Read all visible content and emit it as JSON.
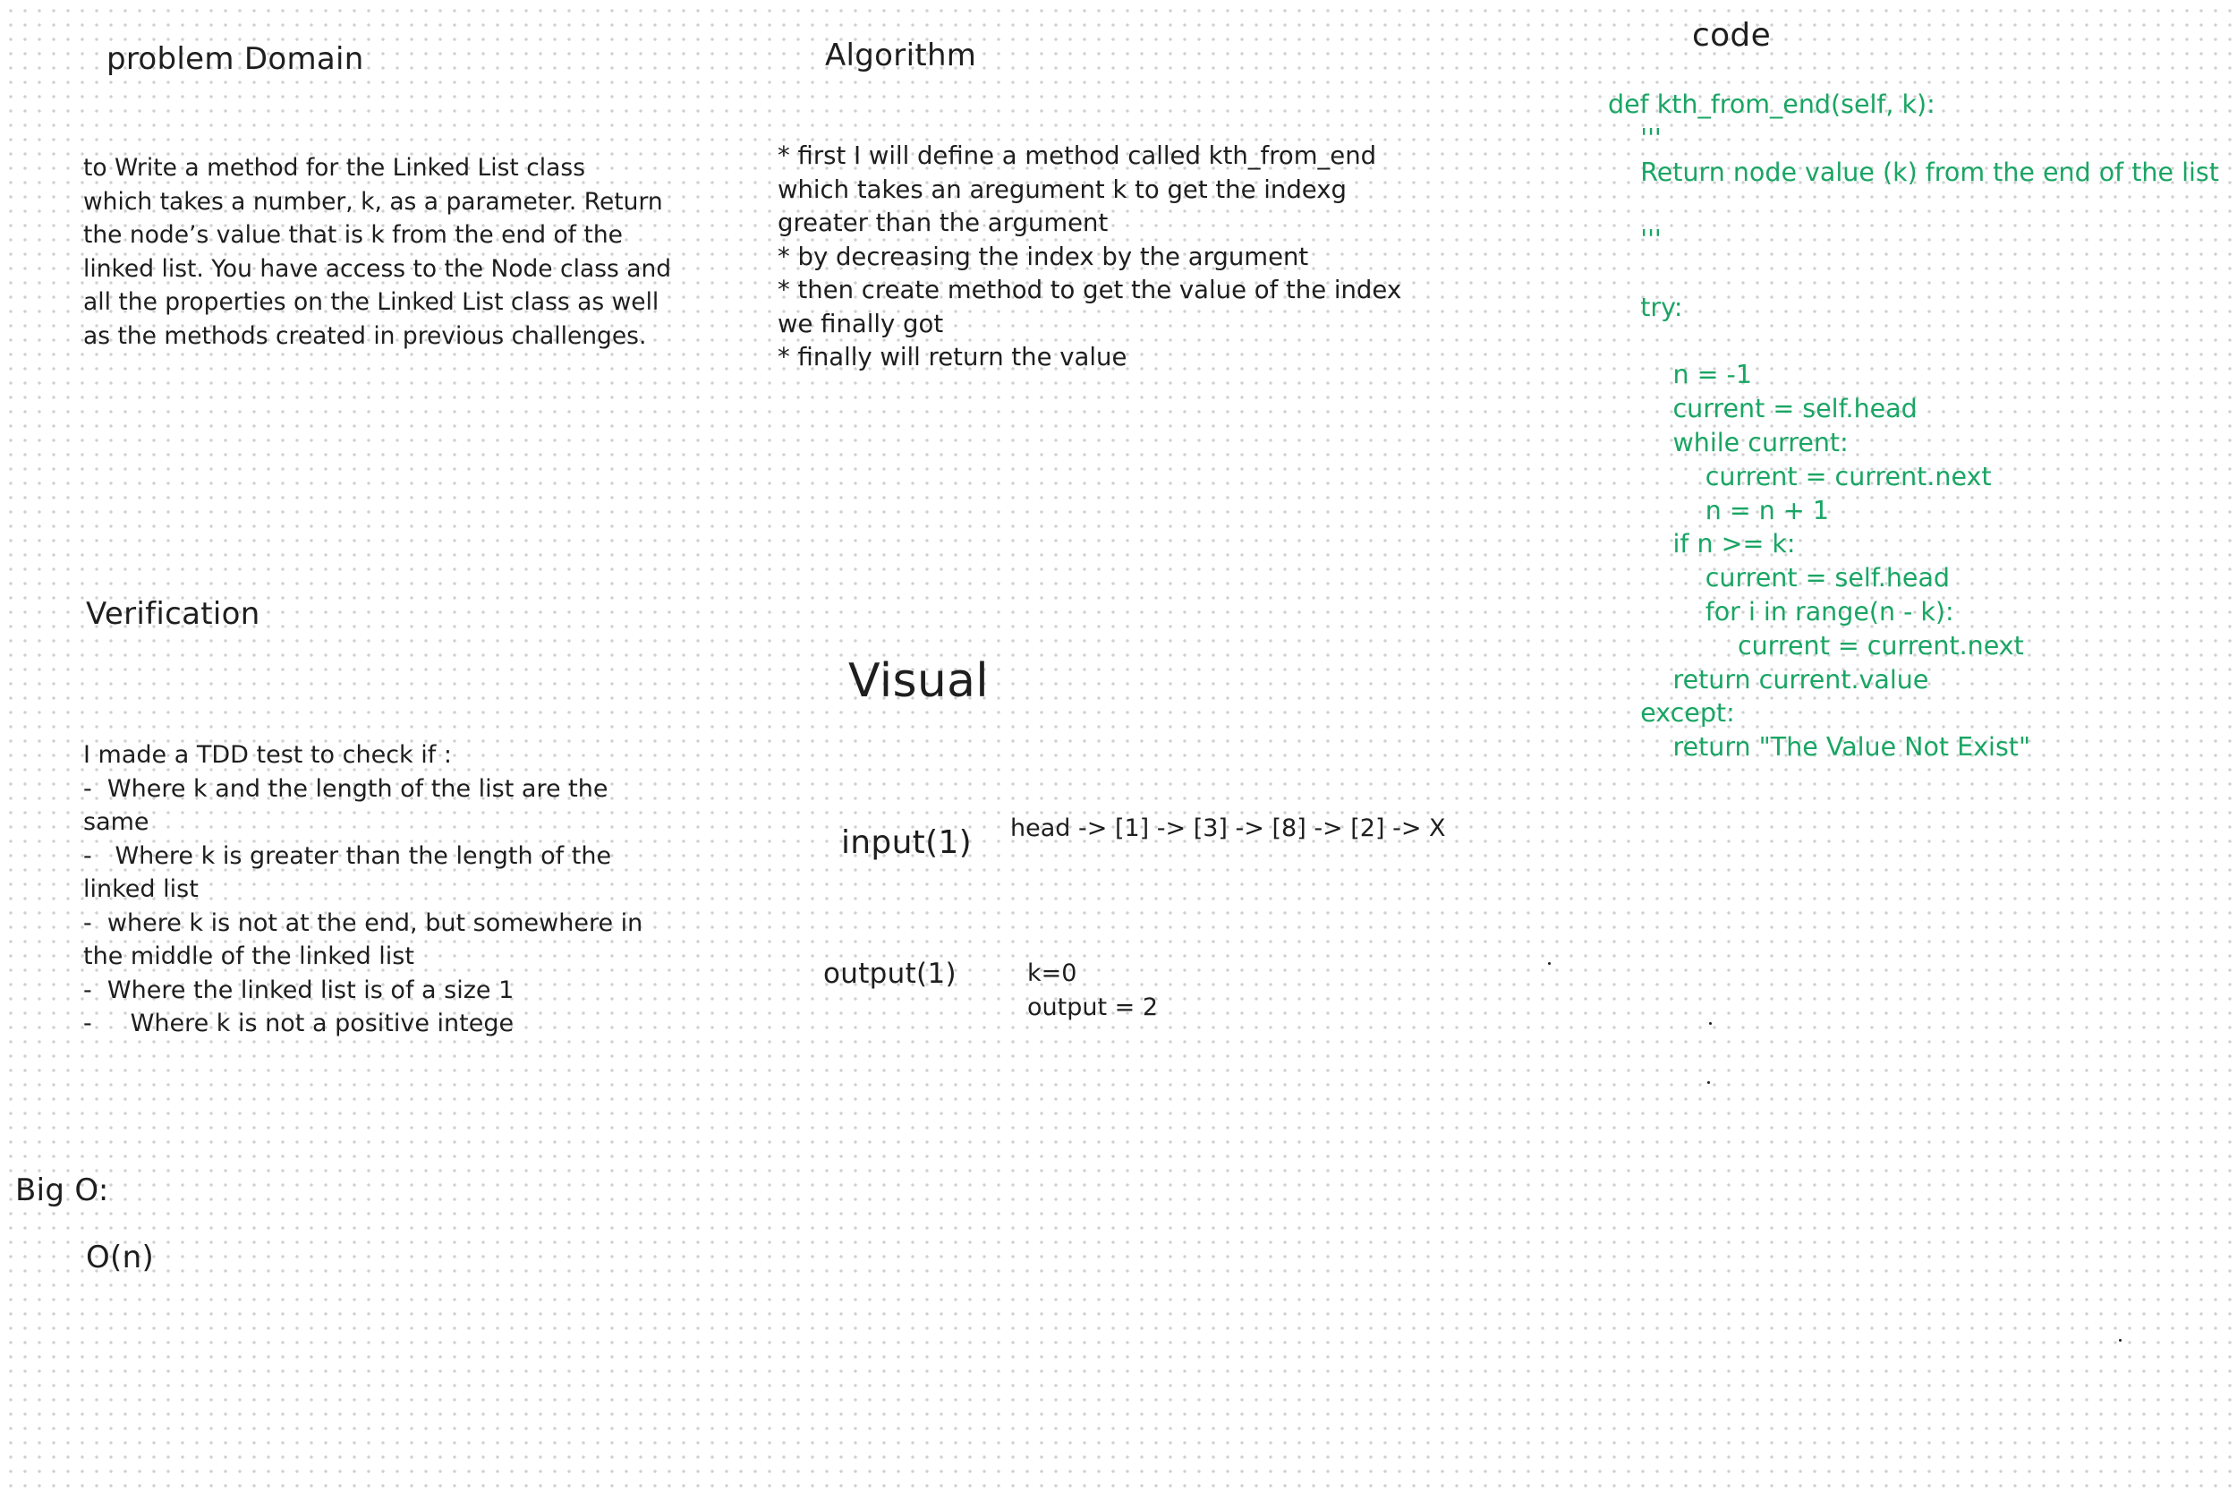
{
  "sections": {
    "problem_domain": {
      "heading": "problem Domain",
      "lines": [
        "to Write a method for the Linked List class",
        "which takes a number, k, as a parameter. Return",
        "the node’s value that is k from the end of the",
        "linked list. You have access to the Node class and",
        "all the properties on the Linked List class as well",
        "as the methods created in previous challenges."
      ]
    },
    "algorithm": {
      "heading": "Algorithm",
      "lines": [
        "* first I will define a method called kth_from_end",
        "which takes an aregument k to get the indexg",
        "greater than the argument",
        "* by decreasing the index by the argument",
        "* then create method to get the value of the index",
        "we finally got",
        "* finally will return the value"
      ]
    },
    "code": {
      "heading": "code",
      "lines": [
        "def kth_from_end(self, k):",
        "    '''",
        "    Return node value (k) from the end of the list",
        "",
        "    '''",
        "",
        "    try:",
        "",
        "        n = -1",
        "        current = self.head",
        "        while current:",
        "            current = current.next",
        "            n = n + 1",
        "        if n >= k:",
        "            current = self.head",
        "            for i in range(n - k):",
        "                current = current.next",
        "        return current.value",
        "    except:",
        "        return \"The Value Not Exist\""
      ]
    },
    "verification": {
      "heading": "Verification",
      "lines": [
        "I made a TDD test to check if :",
        "-  Where k and the length of the list are the",
        "same",
        "-   Where k is greater than the length of the",
        "linked list",
        "-  where k is not at the end, but somewhere in",
        "the middle of the linked list",
        "-  Where the linked list is of a size 1",
        "-     Where k is not a positive intege"
      ]
    },
    "visual": {
      "heading": "Visual",
      "input_label": "input(1)",
      "input_value": "head -> [1] -> [3] -> [8] -> [2] -> X",
      "output_label": "output(1)",
      "output_lines": [
        "k=0",
        "output = 2"
      ]
    },
    "big_o": {
      "heading": "Big O:",
      "value": "O(n)"
    }
  },
  "colors": {
    "ink": "#1e1e1e",
    "code_green": "#1aa564",
    "grid_dot": "#cfcfcf",
    "background": "#ffffff"
  }
}
